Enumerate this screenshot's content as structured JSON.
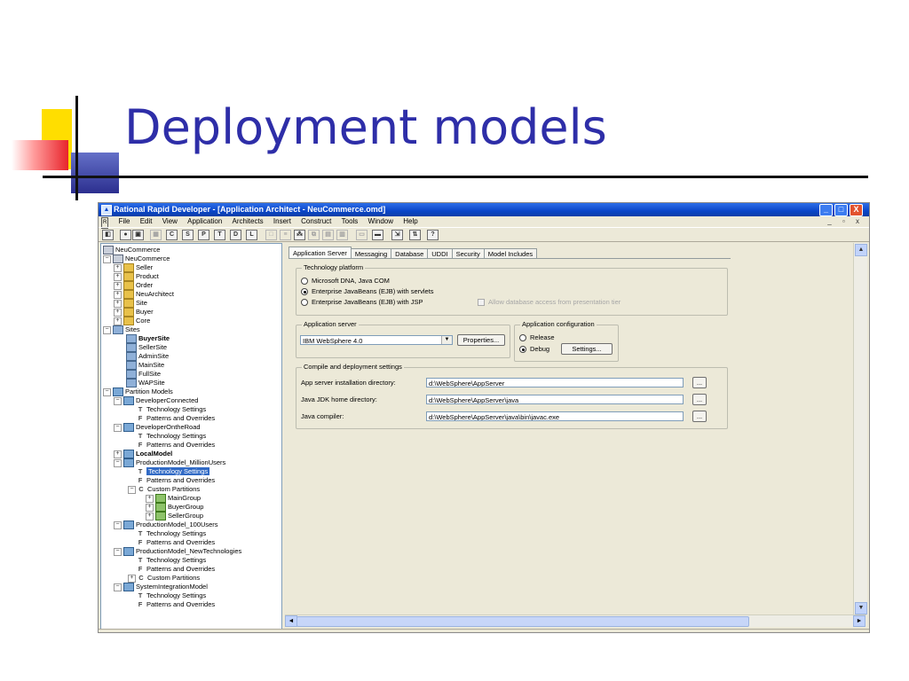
{
  "slide": {
    "title": "Deployment models"
  },
  "window": {
    "title": "Rational Rapid Developer - [Application Architect - NeuCommerce.omd]",
    "controls": {
      "minimize": "_",
      "maximize": "□",
      "close": "X"
    }
  },
  "menu": {
    "items": [
      "File",
      "Edit",
      "View",
      "Application",
      "Architects",
      "Insert",
      "Construct",
      "Tools",
      "Window",
      "Help"
    ],
    "mdi": "_ ▫ x"
  },
  "toolbar": {
    "buttons": [
      "C",
      "S",
      "P",
      "T",
      "D",
      "L"
    ]
  },
  "tree": {
    "root": "NeuCommerce",
    "app": "NeuCommerce",
    "folders": [
      "Seller",
      "Product",
      "Order",
      "NeuArchitect",
      "Site",
      "Buyer",
      "Core"
    ],
    "sites_label": "Sites",
    "sites": [
      "BuyerSite",
      "SellerSite",
      "AdminSite",
      "MainSite",
      "FullSite",
      "WAPSite"
    ],
    "partition_models": "Partition Models",
    "dev_connected": "DeveloperConnected",
    "technology_settings": "Technology Settings",
    "patterns_overrides": "Patterns and Overrides",
    "dev_ontheroad": "DeveloperOntheRoad",
    "local_model": "LocalModel",
    "prod_million": "ProductionModel_MillionUsers",
    "custom_partitions": "Custom Partitions",
    "groups": [
      "MainGroup",
      "BuyerGroup",
      "SellerGroup"
    ],
    "prod_100": "ProductionModel_100Users",
    "prod_new": "ProductionModel_NewTechnologies",
    "sys_integration": "SystemIntegrationModel"
  },
  "tabs": [
    "Application Server",
    "Messaging",
    "Database",
    "UDDI",
    "Security",
    "Model Includes"
  ],
  "technology_platform": {
    "label": "Technology platform",
    "options": [
      "Microsoft DNA, Java COM",
      "Enterprise JavaBeans (EJB) with servlets",
      "Enterprise JavaBeans (EJB) with JSP"
    ],
    "selected_index": 1,
    "allow_db_access": "Allow database access from presentation tier"
  },
  "application_server": {
    "label": "Application server",
    "value": "IBM WebSphere 4.0",
    "properties_button": "Properties..."
  },
  "application_configuration": {
    "label": "Application configuration",
    "release": "Release",
    "debug": "Debug",
    "selected": "Debug",
    "settings_button": "Settings..."
  },
  "compile_settings": {
    "label": "Compile and deployment settings",
    "rows": [
      {
        "label": "App server installation directory:",
        "value": "d:\\WebSphere\\AppServer",
        "browse": "..."
      },
      {
        "label": "Java JDK home directory:",
        "value": "d:\\WebSphere\\AppServer\\java",
        "browse": "..."
      },
      {
        "label": "Java compiler:",
        "value": "d:\\WebSphere\\AppServer\\java\\bin\\javac.exe",
        "browse": "..."
      }
    ]
  }
}
